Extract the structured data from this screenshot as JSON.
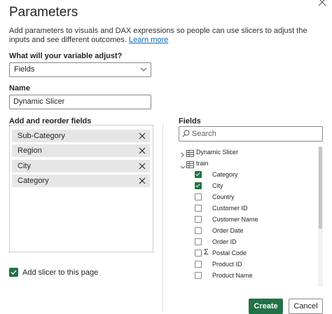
{
  "dialog": {
    "title": "Parameters",
    "description": "Add parameters to visuals and DAX expressions so people can use slicers to adjust the inputs and see different outcomes.",
    "learn_more": "Learn more"
  },
  "variable": {
    "label": "What will your variable adjust?",
    "selected": "Fields"
  },
  "name": {
    "label": "Name",
    "value": "Dynamic Slicer"
  },
  "reorder": {
    "label": "Add and reorder fields",
    "items": [
      "Sub-Category",
      "Region",
      "City",
      "Category"
    ]
  },
  "slicer": {
    "label": "Add slicer to this page",
    "checked": true
  },
  "fields": {
    "label": "Fields",
    "search_placeholder": "Search",
    "tables": [
      "Dynamic Slicer",
      "train"
    ],
    "columns": [
      {
        "name": "Category",
        "checked": true
      },
      {
        "name": "City",
        "checked": true
      },
      {
        "name": "Country",
        "checked": false
      },
      {
        "name": "Customer ID",
        "checked": false
      },
      {
        "name": "Customer Name",
        "checked": false
      },
      {
        "name": "Order Date",
        "checked": false
      },
      {
        "name": "Order ID",
        "checked": false
      },
      {
        "name": "Postal Code",
        "checked": false,
        "sigma": true
      },
      {
        "name": "Product ID",
        "checked": false
      },
      {
        "name": "Product Name",
        "checked": false
      }
    ]
  },
  "buttons": {
    "create": "Create",
    "cancel": "Cancel"
  },
  "colors": {
    "accent": "#217346",
    "link": "#0f6cbd"
  },
  "icons": [
    "close-icon",
    "chevron-down-icon",
    "remove-icon",
    "search-icon",
    "chevron-right-icon",
    "table-icon",
    "sigma-icon",
    "checkbox-icon"
  ]
}
